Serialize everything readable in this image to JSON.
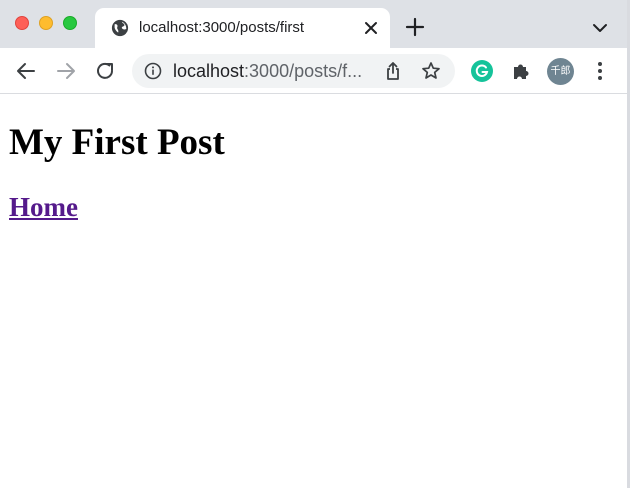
{
  "window_controls": {
    "close": {
      "icon": "close-window-icon",
      "color": "#fe5f57"
    },
    "minimize": {
      "icon": "minimize-window-icon",
      "color": "#febc2e"
    },
    "maximize": {
      "icon": "maximize-window-icon",
      "color": "#28c840"
    }
  },
  "tab": {
    "title": "localhost:3000/posts/first",
    "icon": "globe-icon"
  },
  "toolbar": {
    "url_host": "localhost",
    "url_rest": ":3000/posts/f...",
    "extensions": {
      "grammarly": "G",
      "avatar": "千郎"
    }
  },
  "page": {
    "heading": "My First Post",
    "home_link": "Home",
    "link_color": "#551a8b"
  }
}
